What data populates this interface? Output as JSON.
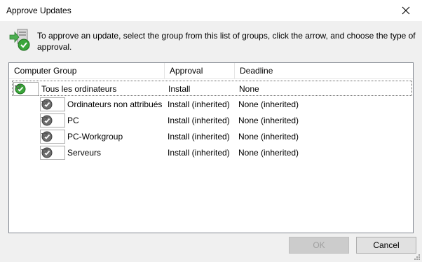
{
  "window": {
    "title": "Approve Updates"
  },
  "instruction": "To approve an update, select the group from this list of groups, click the arrow, and choose the type of approval.",
  "grid": {
    "columns": [
      "Computer Group",
      "Approval",
      "Deadline"
    ],
    "rows": [
      {
        "group": "Tous les ordinateurs",
        "approval": "Install",
        "deadline": "None"
      },
      {
        "group": "Ordinateurs non attribués",
        "approval": "Install (inherited)",
        "deadline": "None (inherited)"
      },
      {
        "group": "PC",
        "approval": "Install (inherited)",
        "deadline": "None (inherited)"
      },
      {
        "group": "PC-Workgroup",
        "approval": "Install (inherited)",
        "deadline": "None (inherited)"
      },
      {
        "group": "Serveurs",
        "approval": "Install (inherited)",
        "deadline": "None (inherited)"
      }
    ]
  },
  "buttons": {
    "ok": "OK",
    "cancel": "Cancel"
  },
  "colors": {
    "approved_green": "#3aa63a",
    "inherited_gray": "#6e6e6e",
    "dialog_bg": "#f0f0f0"
  },
  "icons": {
    "close": "close-icon",
    "header": "approve-computers-icon",
    "approved": "green-check-icon",
    "inherited": "gray-check-icon",
    "dropdown": "dropdown-arrow-icon"
  }
}
